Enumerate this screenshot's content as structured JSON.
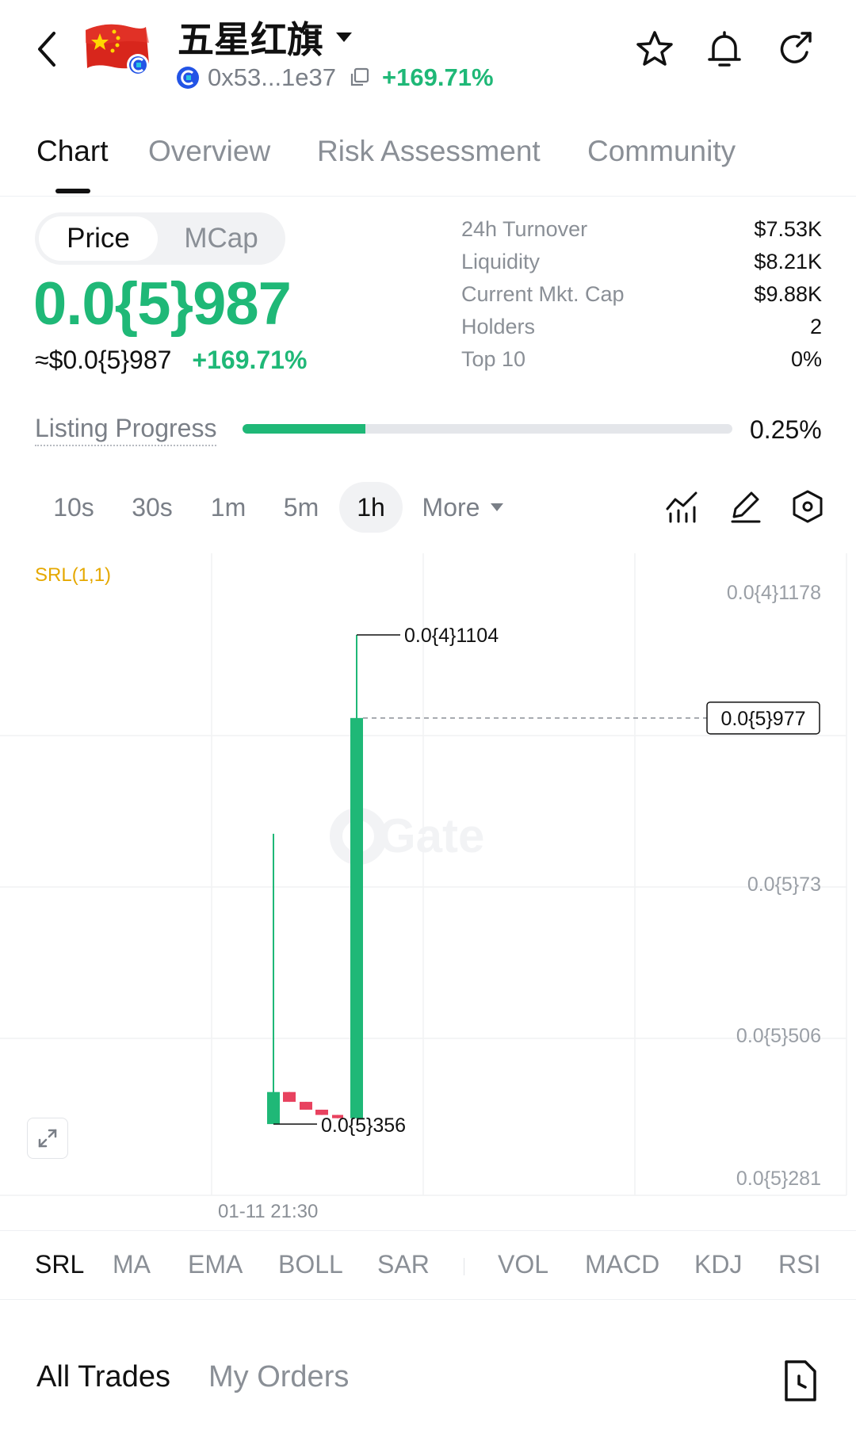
{
  "header": {
    "token_name": "五星红旗",
    "address": "0x53...1e37",
    "change_pct": "+169.71%",
    "icons": [
      "back-icon",
      "token-avatar",
      "chain-icon",
      "copy-icon",
      "star-icon",
      "bell-icon",
      "share-icon"
    ]
  },
  "tabs": [
    {
      "label": "Chart",
      "active": true
    },
    {
      "label": "Overview",
      "active": false
    },
    {
      "label": "Risk Assessment",
      "active": false
    },
    {
      "label": "Community",
      "active": false
    }
  ],
  "price_panel": {
    "toggle": {
      "price": "Price",
      "mcap": "MCap",
      "selected": "Price"
    },
    "price": "0.0{5}987",
    "usd_price": "≈$0.0{5}987",
    "usd_change": "+169.71%"
  },
  "stats": [
    {
      "label": "24h  Turnover",
      "value": "$7.53K"
    },
    {
      "label": "Liquidity",
      "value": "$8.21K"
    },
    {
      "label": "Current Mkt. Cap",
      "value": "$9.88K"
    },
    {
      "label": "Holders",
      "value": "2"
    },
    {
      "label": "Top 10",
      "value": "0%"
    }
  ],
  "listing_progress": {
    "label": "Listing Progress",
    "value": "0.25%",
    "fill_fraction": 0.25
  },
  "timeframes": [
    {
      "label": "10s",
      "active": false
    },
    {
      "label": "30s",
      "active": false
    },
    {
      "label": "1m",
      "active": false
    },
    {
      "label": "5m",
      "active": false
    },
    {
      "label": "1h",
      "active": true
    },
    {
      "label": "More",
      "active": false
    }
  ],
  "chart_tools": [
    "indicator-icon",
    "draw-icon",
    "settings-icon"
  ],
  "chart": {
    "indicator_label": "SRL(1,1)",
    "watermark": "Gate",
    "y_ticks": [
      "0.0{4}1178",
      "0.0{5}73",
      "0.0{5}506",
      "0.0{5}281"
    ],
    "high_label": "0.0{4}1104",
    "low_label": "0.0{5}356",
    "current_label": "0.0{5}977",
    "x_label": "01-11 21:30",
    "colors": {
      "up": "#1fb877",
      "down": "#e8425f",
      "srl": "#e5a800"
    }
  },
  "chart_data": {
    "type": "candlestick",
    "y_unit_note": "price (×1e-5)",
    "ylim": [
      2.81,
      11.78
    ],
    "candles": [
      {
        "open": 3.56,
        "close": 4.05,
        "high": 8.0,
        "low": 3.56,
        "color": "up"
      },
      {
        "open": 4.05,
        "close": 3.9,
        "high": 4.05,
        "low": 3.9,
        "color": "down"
      },
      {
        "open": 3.9,
        "close": 3.78,
        "high": 3.9,
        "low": 3.78,
        "color": "down"
      },
      {
        "open": 3.78,
        "close": 3.7,
        "high": 3.78,
        "low": 3.7,
        "color": "down"
      },
      {
        "open": 3.7,
        "close": 3.65,
        "high": 3.7,
        "low": 3.65,
        "color": "down"
      },
      {
        "open": 3.65,
        "close": 9.77,
        "high": 11.04,
        "low": 3.65,
        "color": "up"
      }
    ],
    "x_labels": [
      "01-11 21:30"
    ],
    "grid": true
  },
  "indicators": [
    {
      "label": "SRL",
      "active": true
    },
    {
      "label": "MA",
      "active": false
    },
    {
      "label": "EMA",
      "active": false
    },
    {
      "label": "BOLL",
      "active": false
    },
    {
      "label": "SAR",
      "active": false
    },
    {
      "label": "VOL",
      "active": false
    },
    {
      "label": "MACD",
      "active": false
    },
    {
      "label": "KDJ",
      "active": false
    },
    {
      "label": "RSI",
      "active": false
    }
  ],
  "bottom_tabs": [
    {
      "label": "All Trades",
      "active": true
    },
    {
      "label": "My Orders",
      "active": false
    }
  ]
}
